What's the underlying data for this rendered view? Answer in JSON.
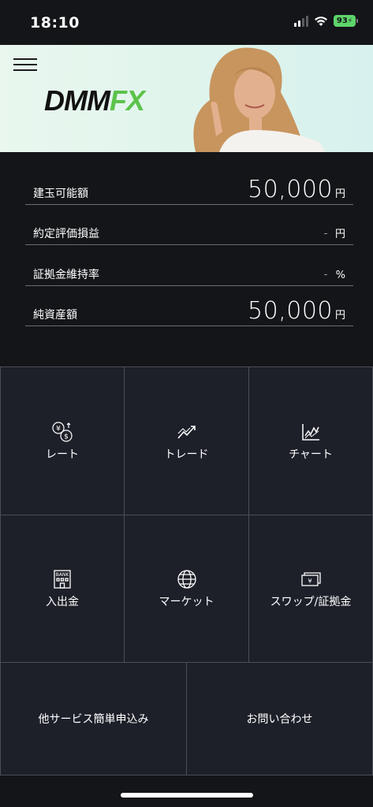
{
  "status_bar": {
    "time": "18:10",
    "battery": "93"
  },
  "banner": {
    "logo_dmm": "DMM",
    "logo_fx": "FX",
    "colors": {
      "fx_green": "#5cc34a",
      "banner_bg": "#e2f6ec"
    }
  },
  "summary": {
    "available_margin": {
      "label": "建玉可能額",
      "value": "50,000",
      "unit": "円"
    },
    "valuation_pl": {
      "label": "約定評価損益",
      "value": "-",
      "unit": "円"
    },
    "margin_ratio": {
      "label": "証拠金維持率",
      "value": "-",
      "unit": "%"
    },
    "net_assets": {
      "label": "純資産額",
      "value": "50,000",
      "unit": "円"
    }
  },
  "menu": {
    "rate": {
      "label": "レート",
      "icon": "currency-exchange-icon"
    },
    "trade": {
      "label": "トレード",
      "icon": "trend-arrow-icon"
    },
    "chart": {
      "label": "チャート",
      "icon": "line-chart-icon"
    },
    "deposit": {
      "label": "入出金",
      "icon": "bank-icon"
    },
    "market": {
      "label": "マーケット",
      "icon": "globe-icon"
    },
    "swap": {
      "label": "スワップ/証拠金",
      "icon": "banknote-icon"
    },
    "other_services": {
      "label": "他サービス簡単申込み"
    },
    "contact": {
      "label": "お問い合わせ"
    }
  },
  "colors": {
    "background": "#141519",
    "cell_bg": "#1d2029",
    "border": "#4b4e57",
    "battery_green": "#5ed46a"
  }
}
